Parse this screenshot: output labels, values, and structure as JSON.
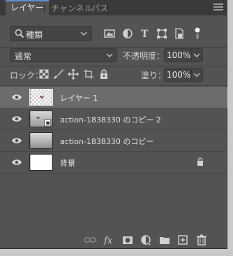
{
  "tabs": [
    {
      "label": "レイヤー",
      "active": true
    },
    {
      "label": "チャンネル",
      "active": false
    },
    {
      "label": "パス",
      "active": false
    }
  ],
  "filter": {
    "kind_label": "種類"
  },
  "blend": {
    "mode": "通常",
    "opacity_label": "不透明度：",
    "opacity_value": "100%"
  },
  "lock": {
    "label": "ロック：",
    "fill_label": "塗り：",
    "fill_value": "100%"
  },
  "layers": [
    {
      "name": "レイヤー 1",
      "selected": true,
      "visible": true,
      "thumbnail": "transparent-with-mark"
    },
    {
      "name": "action-1838330 のコピー 2",
      "selected": false,
      "visible": true,
      "thumbnail": "smart-object"
    },
    {
      "name": "action-1838330 のコピー",
      "selected": false,
      "visible": true,
      "thumbnail": "gray-gradient"
    },
    {
      "name": "背景",
      "selected": false,
      "visible": true,
      "thumbnail": "white",
      "locked": true
    }
  ],
  "colors": {
    "panel_bg": "#535353",
    "tab_bar_bg": "#3a3a3a",
    "selected_row": "#6c6c6c",
    "accent": "#5a8fd6"
  },
  "icons": {
    "filter_icons": [
      "image-filter-icon",
      "adjustment-filter-icon",
      "type-filter-icon",
      "shape-filter-icon",
      "smart-object-filter-icon",
      "filter-toggle-icon"
    ],
    "lock_icons": [
      "lock-transparent-pixels-icon",
      "lock-image-pixels-icon",
      "lock-position-icon",
      "prevent-auto-nesting-icon",
      "lock-all-icon"
    ],
    "bottom_icons": [
      "link-layers-icon",
      "fx-icon",
      "add-mask-icon",
      "adjustment-layer-icon",
      "new-group-icon",
      "new-layer-icon",
      "delete-layer-icon"
    ]
  }
}
